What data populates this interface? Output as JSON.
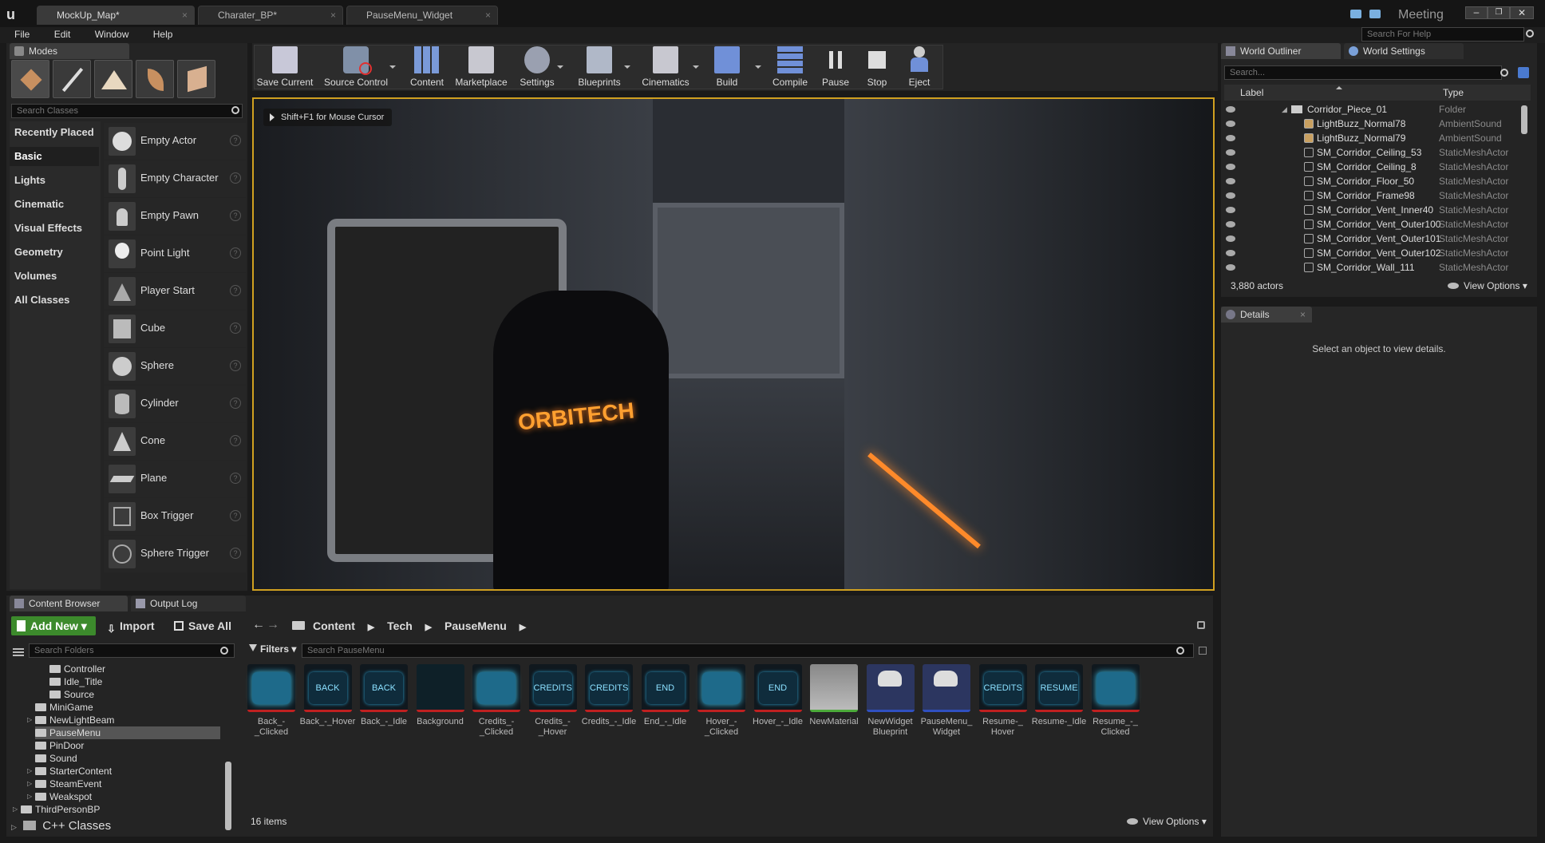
{
  "window": {
    "tabs": [
      "MockUp_Map*",
      "Charater_BP*",
      "PauseMenu_Widget"
    ],
    "meeting": "Meeting",
    "help_search_placeholder": "Search For Help"
  },
  "menu": [
    "File",
    "Edit",
    "Window",
    "Help"
  ],
  "modes": {
    "tab": "Modes",
    "search_placeholder": "Search Classes",
    "categories": [
      "Recently Placed",
      "Basic",
      "Lights",
      "Cinematic",
      "Visual Effects",
      "Geometry",
      "Volumes",
      "All Classes"
    ],
    "items": [
      "Empty Actor",
      "Empty Character",
      "Empty Pawn",
      "Point Light",
      "Player Start",
      "Cube",
      "Sphere",
      "Cylinder",
      "Cone",
      "Plane",
      "Box Trigger",
      "Sphere Trigger"
    ]
  },
  "toolbar": [
    "Save Current",
    "Source Control",
    "Content",
    "Marketplace",
    "Settings",
    "Blueprints",
    "Cinematics",
    "Build",
    "Compile",
    "Pause",
    "Stop",
    "Eject"
  ],
  "viewport": {
    "hint": "Shift+F1 for Mouse Cursor",
    "logo_text": "ORBITECH"
  },
  "outliner": {
    "tabs": [
      "World Outliner",
      "World Settings"
    ],
    "search_placeholder": "Search...",
    "col_label": "Label",
    "col_type": "Type",
    "rows": [
      {
        "name": "Corridor_Piece_01",
        "type": "Folder"
      },
      {
        "name": "LightBuzz_Normal78",
        "type": "AmbientSound"
      },
      {
        "name": "LightBuzz_Normal79",
        "type": "AmbientSound"
      },
      {
        "name": "SM_Corridor_Ceiling_53",
        "type": "StaticMeshActor"
      },
      {
        "name": "SM_Corridor_Ceiling_8",
        "type": "StaticMeshActor"
      },
      {
        "name": "SM_Corridor_Floor_50",
        "type": "StaticMeshActor"
      },
      {
        "name": "SM_Corridor_Frame98",
        "type": "StaticMeshActor"
      },
      {
        "name": "SM_Corridor_Vent_Inner40",
        "type": "StaticMeshActor"
      },
      {
        "name": "SM_Corridor_Vent_Outer100",
        "type": "StaticMeshActor"
      },
      {
        "name": "SM_Corridor_Vent_Outer101",
        "type": "StaticMeshActor"
      },
      {
        "name": "SM_Corridor_Vent_Outer102",
        "type": "StaticMeshActor"
      },
      {
        "name": "SM_Corridor_Wall_111",
        "type": "StaticMeshActor"
      }
    ],
    "count": "3,880 actors",
    "view_options": "View Options"
  },
  "details": {
    "tab": "Details",
    "empty": "Select an object to view details."
  },
  "content_browser": {
    "tabs": [
      "Content Browser",
      "Output Log"
    ],
    "add_new": "Add New",
    "import": "Import",
    "save_all": "Save All",
    "path": [
      "Content",
      "Tech",
      "PauseMenu"
    ],
    "search_folders": "Search Folders",
    "filters": "Filters",
    "search_assets": "Search PauseMenu",
    "folders": [
      {
        "name": "Controller",
        "indent": 2
      },
      {
        "name": "Idle_Title",
        "indent": 2
      },
      {
        "name": "Source",
        "indent": 2
      },
      {
        "name": "MiniGame",
        "indent": 1
      },
      {
        "name": "NewLightBeam",
        "indent": 1
      },
      {
        "name": "PauseMenu",
        "indent": 1
      },
      {
        "name": "PinDoor",
        "indent": 1
      },
      {
        "name": "Sound",
        "indent": 1
      },
      {
        "name": "StarterContent",
        "indent": 1
      },
      {
        "name": "SteamEvent",
        "indent": 1
      },
      {
        "name": "Weakspot",
        "indent": 1
      },
      {
        "name": "ThirdPersonBP",
        "indent": 0
      }
    ],
    "cpp_classes": "C++ Classes",
    "assets": [
      {
        "name": "Back_-_Clicked",
        "thumb": ""
      },
      {
        "name": "Back_-_Hover",
        "thumb": "BACK"
      },
      {
        "name": "Back_-_Idle",
        "thumb": "BACK"
      },
      {
        "name": "Background",
        "thumb": ""
      },
      {
        "name": "Credits_-_Clicked",
        "thumb": ""
      },
      {
        "name": "Credits_-_Hover",
        "thumb": "CREDITS"
      },
      {
        "name": "Credits_-_Idle",
        "thumb": "CREDITS"
      },
      {
        "name": "End_-_Idle",
        "thumb": "END"
      },
      {
        "name": "Hover_-_Clicked",
        "thumb": ""
      },
      {
        "name": "Hover_-_Idle",
        "thumb": "END"
      },
      {
        "name": "NewMaterial",
        "thumb": ""
      },
      {
        "name": "NewWidget Blueprint",
        "thumb": ""
      },
      {
        "name": "PauseMenu_ Widget",
        "thumb": ""
      },
      {
        "name": "Resume-_ Hover",
        "thumb": "CREDITS"
      },
      {
        "name": "Resume-_Idle",
        "thumb": "RESUME"
      },
      {
        "name": "Resume_-_ Clicked",
        "thumb": ""
      }
    ],
    "item_count": "16 items",
    "view_options": "View Options"
  }
}
